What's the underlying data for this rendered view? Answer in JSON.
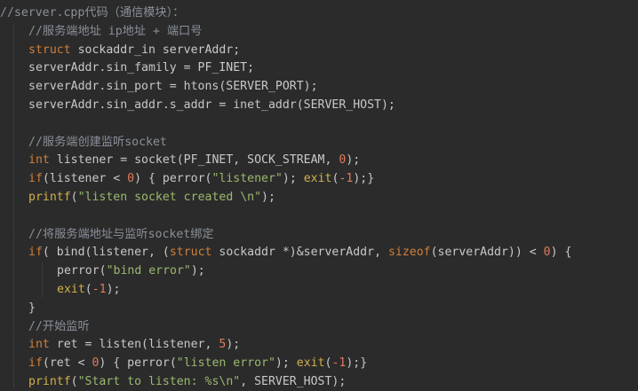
{
  "theme": {
    "background": "#2b2b2b",
    "colors": {
      "comment": "#8a8f98",
      "keyword": "#cf7f3a",
      "type": "#cf7f3a",
      "string": "#9ab86f",
      "number": "#e07b5a",
      "func": "#cfb04a",
      "plain": "#c8c8c8"
    }
  },
  "code": {
    "lines": [
      {
        "indent": 0,
        "tokens": [
          {
            "t": "//server.cpp代码（通信模块）：",
            "k": "comment"
          }
        ]
      },
      {
        "indent": 1,
        "tokens": [
          {
            "t": "//服务端地址 ip地址 + 端口号",
            "k": "comment"
          }
        ]
      },
      {
        "indent": 1,
        "tokens": [
          {
            "t": "struct",
            "k": "keyword"
          },
          {
            "t": " sockaddr_in serverAddr;",
            "k": "plain"
          }
        ]
      },
      {
        "indent": 1,
        "tokens": [
          {
            "t": "serverAddr.sin_family = PF_INET;",
            "k": "plain"
          }
        ]
      },
      {
        "indent": 1,
        "tokens": [
          {
            "t": "serverAddr.sin_port = htons(SERVER_PORT);",
            "k": "plain"
          }
        ]
      },
      {
        "indent": 1,
        "tokens": [
          {
            "t": "serverAddr.sin_addr.s_addr = inet_addr(SERVER_HOST);",
            "k": "plain"
          }
        ]
      },
      {
        "indent": 0,
        "tokens": []
      },
      {
        "indent": 1,
        "tokens": [
          {
            "t": "//服务端创建监听socket",
            "k": "comment"
          }
        ]
      },
      {
        "indent": 1,
        "tokens": [
          {
            "t": "int",
            "k": "type"
          },
          {
            "t": " listener = socket(PF_INET, SOCK_STREAM, ",
            "k": "plain"
          },
          {
            "t": "0",
            "k": "number"
          },
          {
            "t": ");",
            "k": "plain"
          }
        ]
      },
      {
        "indent": 1,
        "tokens": [
          {
            "t": "if",
            "k": "keyword"
          },
          {
            "t": "(listener < ",
            "k": "plain"
          },
          {
            "t": "0",
            "k": "number"
          },
          {
            "t": ") { perror(",
            "k": "plain"
          },
          {
            "t": "\"listener\"",
            "k": "string"
          },
          {
            "t": "); ",
            "k": "plain"
          },
          {
            "t": "exit",
            "k": "func"
          },
          {
            "t": "(",
            "k": "plain"
          },
          {
            "t": "-1",
            "k": "number"
          },
          {
            "t": ");}",
            "k": "plain"
          }
        ]
      },
      {
        "indent": 1,
        "tokens": [
          {
            "t": "printf",
            "k": "func"
          },
          {
            "t": "(",
            "k": "plain"
          },
          {
            "t": "\"listen socket created \\n\"",
            "k": "string"
          },
          {
            "t": ");",
            "k": "plain"
          }
        ]
      },
      {
        "indent": 0,
        "tokens": []
      },
      {
        "indent": 1,
        "tokens": [
          {
            "t": "//将服务端地址与监听socket绑定",
            "k": "comment"
          }
        ]
      },
      {
        "indent": 1,
        "tokens": [
          {
            "t": "if",
            "k": "keyword"
          },
          {
            "t": "( bind(listener, (",
            "k": "plain"
          },
          {
            "t": "struct",
            "k": "keyword"
          },
          {
            "t": " sockaddr *)&serverAddr, ",
            "k": "plain"
          },
          {
            "t": "sizeof",
            "k": "keyword"
          },
          {
            "t": "(serverAddr)) < ",
            "k": "plain"
          },
          {
            "t": "0",
            "k": "number"
          },
          {
            "t": ") {",
            "k": "plain"
          }
        ]
      },
      {
        "indent": 2,
        "tokens": [
          {
            "t": "perror(",
            "k": "plain"
          },
          {
            "t": "\"bind error\"",
            "k": "string"
          },
          {
            "t": ");",
            "k": "plain"
          }
        ]
      },
      {
        "indent": 2,
        "tokens": [
          {
            "t": "exit",
            "k": "func"
          },
          {
            "t": "(",
            "k": "plain"
          },
          {
            "t": "-1",
            "k": "number"
          },
          {
            "t": ");",
            "k": "plain"
          }
        ]
      },
      {
        "indent": 1,
        "tokens": [
          {
            "t": "}",
            "k": "plain"
          }
        ]
      },
      {
        "indent": 1,
        "tokens": [
          {
            "t": "//开始监听",
            "k": "comment"
          }
        ]
      },
      {
        "indent": 1,
        "tokens": [
          {
            "t": "int",
            "k": "type"
          },
          {
            "t": " ret = listen(listener, ",
            "k": "plain"
          },
          {
            "t": "5",
            "k": "number"
          },
          {
            "t": ");",
            "k": "plain"
          }
        ]
      },
      {
        "indent": 1,
        "tokens": [
          {
            "t": "if",
            "k": "keyword"
          },
          {
            "t": "(ret < ",
            "k": "plain"
          },
          {
            "t": "0",
            "k": "number"
          },
          {
            "t": ") { perror(",
            "k": "plain"
          },
          {
            "t": "\"listen error\"",
            "k": "string"
          },
          {
            "t": "); ",
            "k": "plain"
          },
          {
            "t": "exit",
            "k": "func"
          },
          {
            "t": "(",
            "k": "plain"
          },
          {
            "t": "-1",
            "k": "number"
          },
          {
            "t": ");}",
            "k": "plain"
          }
        ]
      },
      {
        "indent": 1,
        "tokens": [
          {
            "t": "printf",
            "k": "func"
          },
          {
            "t": "(",
            "k": "plain"
          },
          {
            "t": "\"Start to listen: %s\\n\"",
            "k": "string"
          },
          {
            "t": ", SERVER_HOST);",
            "k": "plain"
          }
        ]
      }
    ]
  }
}
